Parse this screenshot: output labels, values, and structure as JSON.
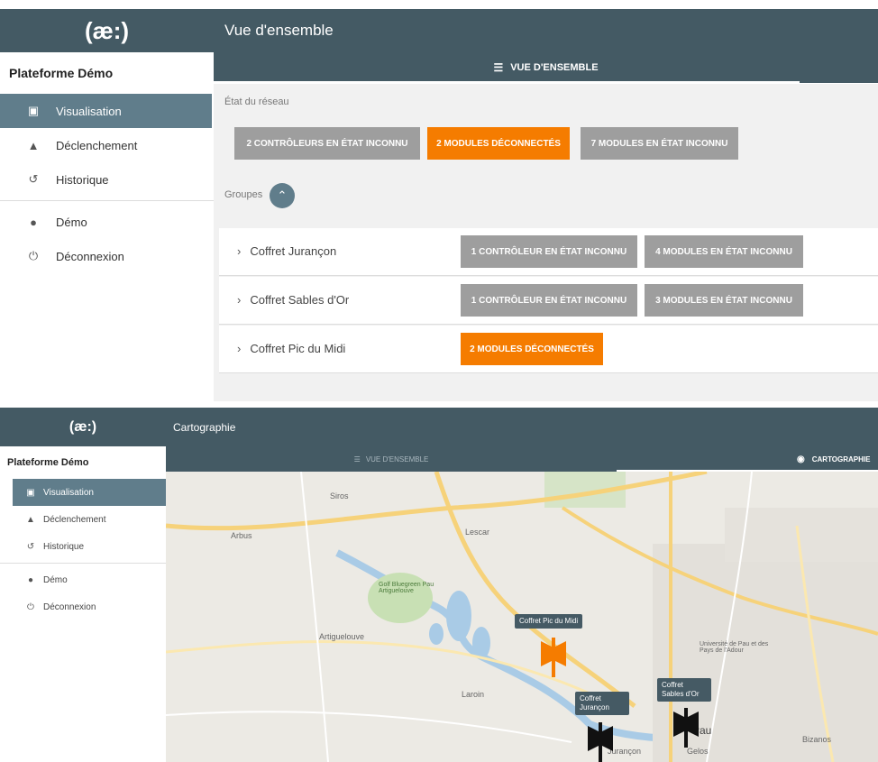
{
  "overview_screen": {
    "logo": "(æ:)",
    "header_title": "Vue d'ensemble",
    "sidebar": {
      "platform": "Plateforme Démo",
      "items": [
        {
          "label": "Visualisation",
          "icon": "monitor-icon"
        },
        {
          "label": "Déclenchement",
          "icon": "bell-icon"
        },
        {
          "label": "Historique",
          "icon": "history-icon"
        },
        {
          "label": "Démo",
          "icon": "user-icon"
        },
        {
          "label": "Déconnexion",
          "icon": "power-icon"
        }
      ]
    },
    "tab_label": "VUE D'ENSEMBLE",
    "network_state_label": "État du réseau",
    "network_buttons": [
      {
        "label": "2 CONTRÔLEURS EN ÉTAT INCONNU",
        "status": "grey"
      },
      {
        "label": "2 MODULES DÉCONNECTÉS",
        "status": "orange"
      },
      {
        "label": "7 MODULES EN ÉTAT INCONNU",
        "status": "grey"
      }
    ],
    "groups_label": "Groupes",
    "groups": [
      {
        "name": "Coffret Jurançon",
        "badges": [
          "1 CONTRÔLEUR EN ÉTAT INCONNU",
          "4 MODULES EN ÉTAT INCONNU"
        ]
      },
      {
        "name": "Coffret Sables d'Or",
        "badges": [
          "1 CONTRÔLEUR EN ÉTAT INCONNU",
          "3 MODULES EN ÉTAT INCONNU"
        ]
      },
      {
        "name": "Coffret Pic du Midi",
        "badges": [
          "2 MODULES DÉCONNECTÉS"
        ]
      }
    ]
  },
  "map_screen": {
    "logo": "(æ:)",
    "header_title": "Cartographie",
    "sidebar": {
      "platform": "Plateforme Démo",
      "items": [
        {
          "label": "Visualisation",
          "icon": "monitor-icon"
        },
        {
          "label": "Déclenchement",
          "icon": "bell-icon"
        },
        {
          "label": "Historique",
          "icon": "history-icon"
        },
        {
          "label": "Démo",
          "icon": "user-icon"
        },
        {
          "label": "Déconnexion",
          "icon": "power-icon"
        }
      ]
    },
    "tabs": [
      "VUE D'ENSEMBLE",
      "CARTOGRAPHIE"
    ],
    "map": {
      "places": [
        "Siros",
        "Arbus",
        "Artiguelouve",
        "Golf Bluegreen Pau Artiguelouve",
        "Lescar",
        "Laroin",
        "Pau",
        "Jurançon",
        "Gelos",
        "Bizanos",
        "Université de Pau et des Pays de l'Adour"
      ],
      "markers": [
        {
          "label": "Coffret Pic du Midi",
          "color": "#f57c00"
        },
        {
          "label": "Coffret Jurançon",
          "color": "#111111"
        },
        {
          "label": "Coffret Sables d'Or",
          "color": "#111111"
        }
      ]
    }
  },
  "colors": {
    "header": "#445a64",
    "accent": "#607d8b",
    "warning": "#f57c00",
    "neutral": "#9e9e9e"
  }
}
